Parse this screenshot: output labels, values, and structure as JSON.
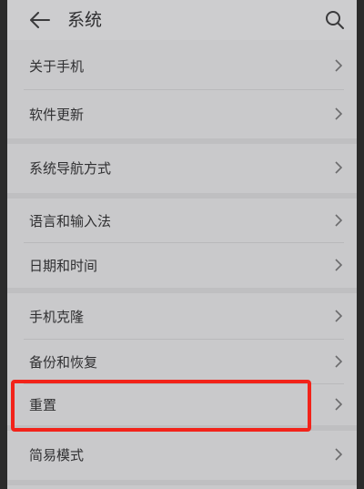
{
  "header": {
    "title": "系统",
    "back_icon": "arrow-left-icon",
    "search_icon": "search-icon"
  },
  "items": [
    {
      "label": "关于手机"
    },
    {
      "label": "软件更新"
    },
    {
      "label": "系统导航方式"
    },
    {
      "label": "语言和输入法"
    },
    {
      "label": "日期和时间"
    },
    {
      "label": "手机克隆"
    },
    {
      "label": "备份和恢复"
    },
    {
      "label": "重置"
    },
    {
      "label": "简易模式"
    }
  ],
  "annotation": {
    "color": "#f2231a",
    "highlighted_item": "重置"
  }
}
